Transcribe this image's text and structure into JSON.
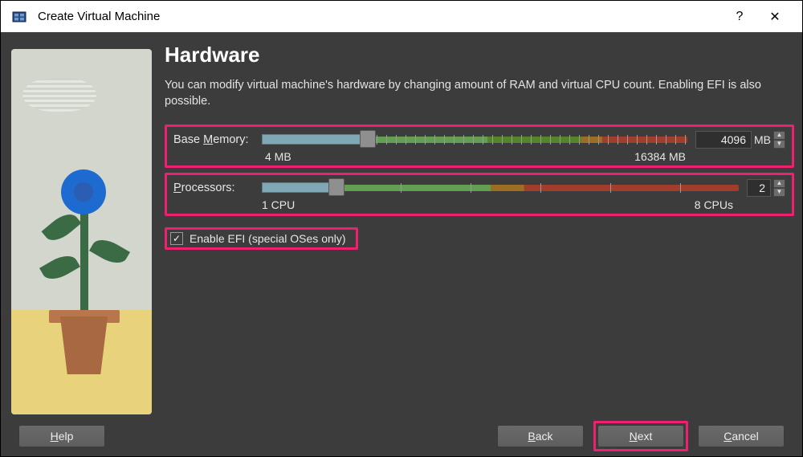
{
  "window": {
    "title": "Create Virtual Machine",
    "help_icon": "?",
    "close_icon": "✕"
  },
  "page": {
    "heading": "Hardware",
    "description": "You can modify virtual machine's hardware by changing amount of RAM and virtual CPU count. Enabling EFI is also possible."
  },
  "memory": {
    "label_prefix": "Base ",
    "label_underline": "M",
    "label_suffix": "emory:",
    "min_label": "4 MB",
    "max_label": "16384 MB",
    "value": "4096",
    "unit": "MB"
  },
  "cpu": {
    "label_underline": "P",
    "label_suffix": "rocessors:",
    "min_label": "1 CPU",
    "max_label": "8 CPUs",
    "value": "2"
  },
  "efi": {
    "label_underline": "E",
    "label_suffix": "nable EFI (special OSes only)",
    "checked": true
  },
  "buttons": {
    "help_underline": "H",
    "help_suffix": "elp",
    "back_underline": "B",
    "back_suffix": "ack",
    "next_underline": "N",
    "next_suffix": "ext",
    "cancel_underline": "C",
    "cancel_suffix": "ancel"
  },
  "colors": {
    "highlight": "#ef206f",
    "background": "#3c3c3c",
    "slider_safe": "#629f52",
    "slider_warn": "#9b6e23",
    "slider_danger": "#a03d2b"
  }
}
